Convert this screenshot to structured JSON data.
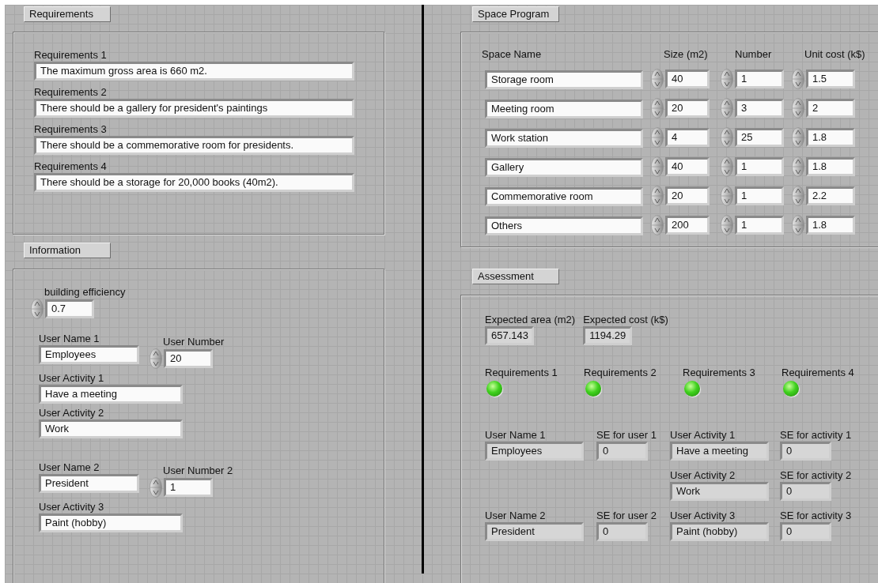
{
  "requirements": {
    "title": "Requirements",
    "items": [
      {
        "label": "Requirements 1",
        "value": "The maximum gross area is 660 m2."
      },
      {
        "label": "Requirements 2",
        "value": "There should be a gallery for president's paintings"
      },
      {
        "label": "Requirements 3",
        "value": "There should be a commemorative room for presidents."
      },
      {
        "label": "Requirements 4",
        "value": "There should be a storage for 20,000 books (40m2)."
      }
    ]
  },
  "information": {
    "title": "Information",
    "efficiency": {
      "label": "building efficiency",
      "value": "0.7"
    },
    "users": [
      {
        "name_label": "User Name 1",
        "name": "Employees",
        "number_label": "User Number",
        "number": "20",
        "activities": [
          {
            "label": "User Activity 1",
            "value": "Have a meeting"
          },
          {
            "label": "User Activity 2",
            "value": "Work"
          }
        ]
      },
      {
        "name_label": "User Name 2",
        "name": "President",
        "number_label": "User Number 2",
        "number": "1",
        "activities": [
          {
            "label": "User Activity 3",
            "value": "Paint (hobby)"
          }
        ]
      }
    ]
  },
  "space_program": {
    "title": "Space Program",
    "columns": [
      "Space Name",
      "Size (m2)",
      "Number",
      "Unit cost (k$)"
    ],
    "rows": [
      {
        "name": "Storage room",
        "size": "40",
        "number": "1",
        "unit_cost": "1.5"
      },
      {
        "name": "Meeting room",
        "size": "20",
        "number": "3",
        "unit_cost": "2"
      },
      {
        "name": "Work station",
        "size": "4",
        "number": "25",
        "unit_cost": "1.8"
      },
      {
        "name": "Gallery",
        "size": "40",
        "number": "1",
        "unit_cost": "1.8"
      },
      {
        "name": "Commemorative room",
        "size": "20",
        "number": "1",
        "unit_cost": "2.2"
      },
      {
        "name": "Others",
        "size": "200",
        "number": "1",
        "unit_cost": "1.8"
      }
    ]
  },
  "assessment": {
    "title": "Assessment",
    "expected_area": {
      "label": "Expected area (m2)",
      "value": "657.143"
    },
    "expected_cost": {
      "label": "Expected cost (k$)",
      "value": "1194.29"
    },
    "indicators": [
      {
        "label": "Requirements 1",
        "on": true
      },
      {
        "label": "Requirements 2",
        "on": true
      },
      {
        "label": "Requirements 3",
        "on": true
      },
      {
        "label": "Requirements 4",
        "on": true
      }
    ],
    "users": [
      {
        "name_label": "User Name 1",
        "name": "Employees",
        "se_label": "SE for user 1",
        "se": "0",
        "activities": [
          {
            "label": "User Activity 1",
            "value": "Have a meeting",
            "se_label": "SE for activity 1",
            "se": "0"
          },
          {
            "label": "User Activity 2",
            "value": "Work",
            "se_label": "SE for activity 2",
            "se": "0"
          }
        ]
      },
      {
        "name_label": "User Name 2",
        "name": "President",
        "se_label": "SE for user 2",
        "se": "0",
        "activities": [
          {
            "label": "User Activity 3",
            "value": "Paint (hobby)",
            "se_label": "SE for activity 3",
            "se": "0"
          }
        ]
      }
    ]
  }
}
